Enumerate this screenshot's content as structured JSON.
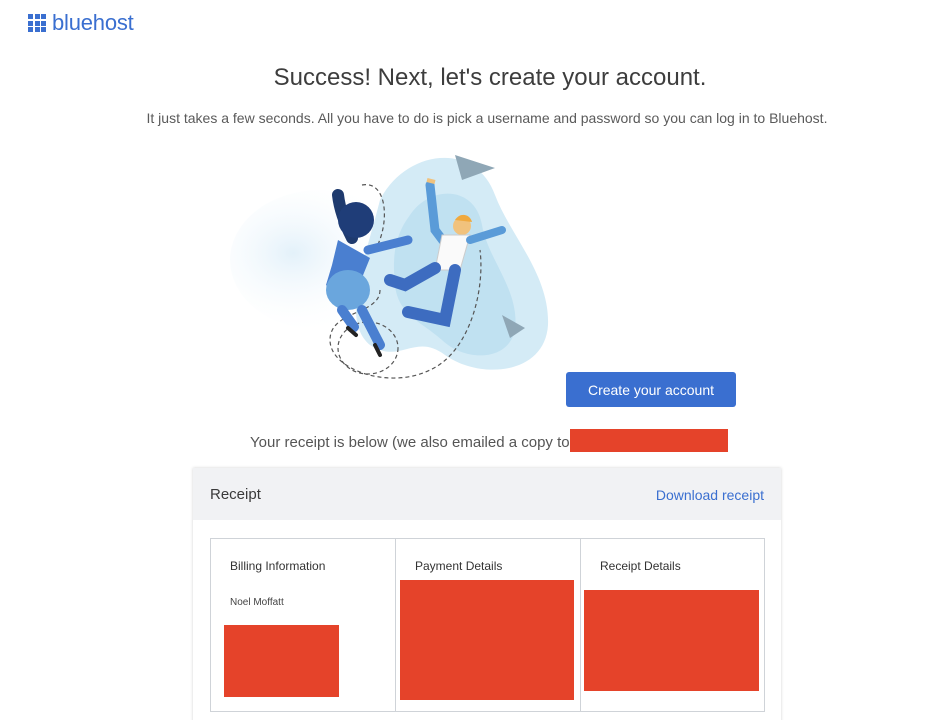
{
  "brand": {
    "name": "bluehost",
    "color": "#3a6fd0"
  },
  "hero": {
    "title": "Success! Next, let's create your account.",
    "subtitle": "It just takes a few seconds. All you have to do is pick a username and password so you can log in to Bluehost."
  },
  "cta": {
    "label": "Create your account"
  },
  "receipt_note": "Your receipt is below (we also emailed a copy to",
  "receipt": {
    "title": "Receipt",
    "download_label": "Download receipt",
    "columns": [
      {
        "title": "Billing Information",
        "name": "Noel Moffatt"
      },
      {
        "title": "Payment Details"
      },
      {
        "title": "Receipt Details"
      }
    ]
  },
  "colors": {
    "accent": "#3a6fd0",
    "redaction": "#e5432a",
    "header_bg": "#f1f2f4"
  }
}
